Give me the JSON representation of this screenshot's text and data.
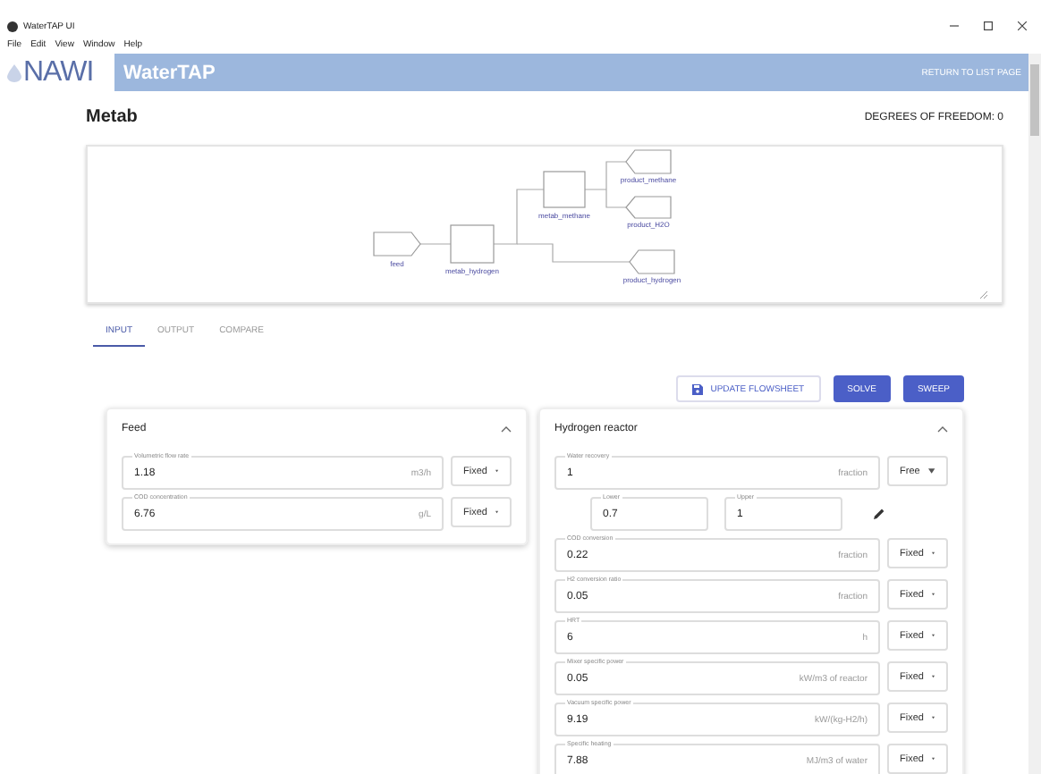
{
  "window": {
    "title": "WaterTAP UI",
    "menu": [
      "File",
      "Edit",
      "View",
      "Window",
      "Help"
    ]
  },
  "header": {
    "logo": "NAWI",
    "app_name": "WaterTAP",
    "link": "RETURN TO LIST PAGE"
  },
  "page": {
    "title": "Metab",
    "degrees_of_freedom": "DEGREES OF FREEDOM: 0"
  },
  "diagram": {
    "nodes": [
      {
        "kind": "feed",
        "label": "feed"
      },
      {
        "kind": "unit",
        "label": "metab_hydrogen"
      },
      {
        "kind": "unit",
        "label": "metab_methane"
      },
      {
        "kind": "product",
        "label": "product_methane"
      },
      {
        "kind": "product",
        "label": "product_H2O"
      },
      {
        "kind": "product",
        "label": "product_hydrogen"
      }
    ]
  },
  "tabs": [
    {
      "label": "INPUT",
      "selected": true
    },
    {
      "label": "OUTPUT",
      "selected": false
    },
    {
      "label": "COMPARE",
      "selected": false
    }
  ],
  "buttons": [
    {
      "label": "UPDATE FLOWSHEET",
      "kind": "outlined"
    },
    {
      "label": "SOLVE",
      "kind": "filled"
    },
    {
      "label": "SWEEP",
      "kind": "filled"
    }
  ],
  "sections": [
    {
      "title": "Feed",
      "expanded": true,
      "variables": [
        {
          "label": "Volumetric flow rate",
          "value": "1.18",
          "unit": "m3/h",
          "fixing": "Fixed"
        },
        {
          "label": "COD concentration",
          "value": "6.76",
          "unit": "g/L",
          "fixing": "Fixed"
        }
      ]
    },
    {
      "title": "Hydrogen reactor",
      "expanded": true,
      "variables": [
        {
          "label": "Water recovery",
          "value": "1",
          "unit": "fraction",
          "fixing": "Free",
          "bounds": {
            "lower": {
              "label": "Lower",
              "value": "0.7"
            },
            "upper": {
              "label": "Upper",
              "value": "1"
            }
          }
        },
        {
          "label": "COD conversion",
          "value": "0.22",
          "unit": "fraction",
          "fixing": "Fixed"
        },
        {
          "label": "H2 conversion ratio",
          "value": "0.05",
          "unit": "fraction",
          "fixing": "Fixed"
        },
        {
          "label": "HRT",
          "value": "6",
          "unit": "h",
          "fixing": "Fixed"
        },
        {
          "label": "Mixer specific power",
          "value": "0.05",
          "unit": "kW/m3 of reactor",
          "fixing": "Fixed"
        },
        {
          "label": "Vacuum specific power",
          "value": "9.19",
          "unit": "kW/(kg-H2/h)",
          "fixing": "Fixed"
        },
        {
          "label": "Specific heating",
          "value": "7.88",
          "unit": "MJ/m3 of water",
          "fixing": "Fixed"
        }
      ]
    }
  ]
}
